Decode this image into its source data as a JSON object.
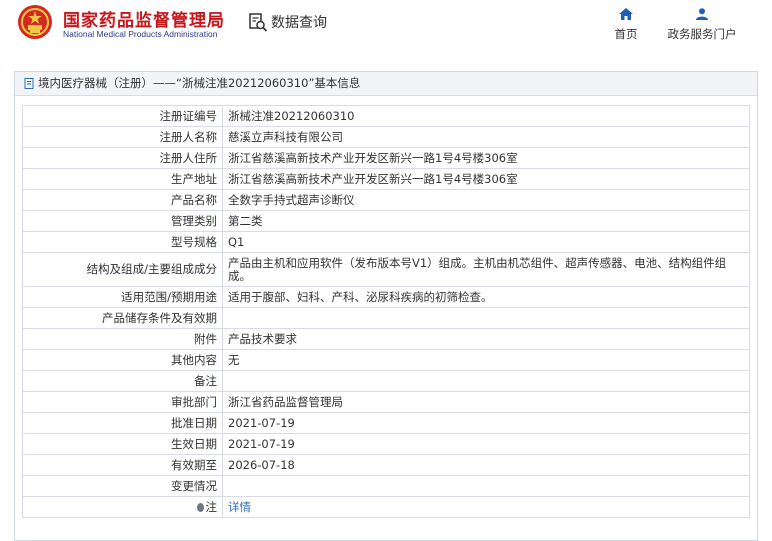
{
  "header": {
    "brand_cn": "国家药品监督管理局",
    "brand_en": "National Medical Products Administration",
    "query_label": "数据查询",
    "nav": [
      {
        "label": "首页",
        "icon": "home-icon"
      },
      {
        "label": "政务服务门户",
        "icon": "user-icon"
      }
    ]
  },
  "panel": {
    "title": "境内医疗器械（注册）——“浙械注准20212060310”基本信息"
  },
  "rows": [
    {
      "label": "注册证编号",
      "value": "浙械注准20212060310"
    },
    {
      "label": "注册人名称",
      "value": "慈溪立声科技有限公司"
    },
    {
      "label": "注册人住所",
      "value": "浙江省慈溪高新技术产业开发区新兴一路1号4号楼306室"
    },
    {
      "label": "生产地址",
      "value": "浙江省慈溪高新技术产业开发区新兴一路1号4号楼306室"
    },
    {
      "label": "产品名称",
      "value": "全数字手持式超声诊断仪"
    },
    {
      "label": "管理类别",
      "value": "第二类"
    },
    {
      "label": "型号规格",
      "value": "Q1"
    },
    {
      "label": "结构及组成/主要组成成分",
      "value": "产品由主机和应用软件（发布版本号V1）组成。主机由机芯组件、超声传感器、电池、结构组件组成。"
    },
    {
      "label": "适用范围/预期用途",
      "value": "适用于腹部、妇科、产科、泌尿科疾病的初筛检查。"
    },
    {
      "label": "产品储存条件及有效期",
      "value": ""
    },
    {
      "label": "附件",
      "value": "产品技术要求"
    },
    {
      "label": "其他内容",
      "value": "无"
    },
    {
      "label": "备注",
      "value": ""
    },
    {
      "label": "审批部门",
      "value": "浙江省药品监督管理局"
    },
    {
      "label": "批准日期",
      "value": "2021-07-19"
    },
    {
      "label": "生效日期",
      "value": "2021-07-19"
    },
    {
      "label": "有效期至",
      "value": "2026-07-18"
    },
    {
      "label": "变更情况",
      "value": ""
    }
  ],
  "note": {
    "label": "注",
    "link": "详情"
  },
  "colors": {
    "brand_red": "#c8161d",
    "brand_blue": "#2b3a8c",
    "nav_blue": "#1f5fb8",
    "link": "#2c6fb7"
  }
}
